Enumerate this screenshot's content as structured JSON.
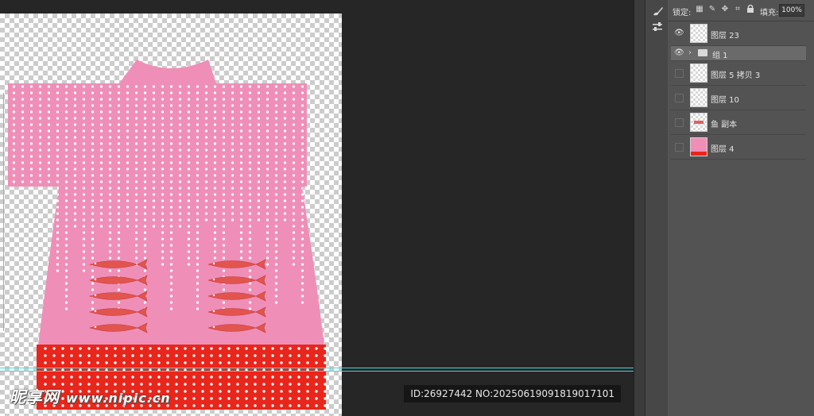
{
  "panel": {
    "lock_label": "锁定:",
    "fill_label": "填充:",
    "fill_value": "100%",
    "layers": [
      {
        "name": "图层 23",
        "visible": true,
        "thumb": "transparent"
      },
      {
        "name": "组 1",
        "visible": true,
        "thumb": "folder"
      },
      {
        "name": "图层 5 拷贝 3",
        "visible": false,
        "thumb": "transparent"
      },
      {
        "name": "图层 10",
        "visible": false,
        "thumb": "transparent"
      },
      {
        "name": "鱼 副本",
        "visible": false,
        "thumb": "fish"
      },
      {
        "name": "图层 4",
        "visible": false,
        "thumb": "pink"
      }
    ]
  },
  "watermark": {
    "left_text": "昵享网",
    "left_url": "www.nipic.cn",
    "right_text": "ID:26927442 NO:20250619091819017101"
  },
  "colors": {
    "dress_pink": "#ef8fb8",
    "hem_red": "#e8261b",
    "fish_red": "#e2544e",
    "guide_cyan": "#4fd3d8"
  }
}
